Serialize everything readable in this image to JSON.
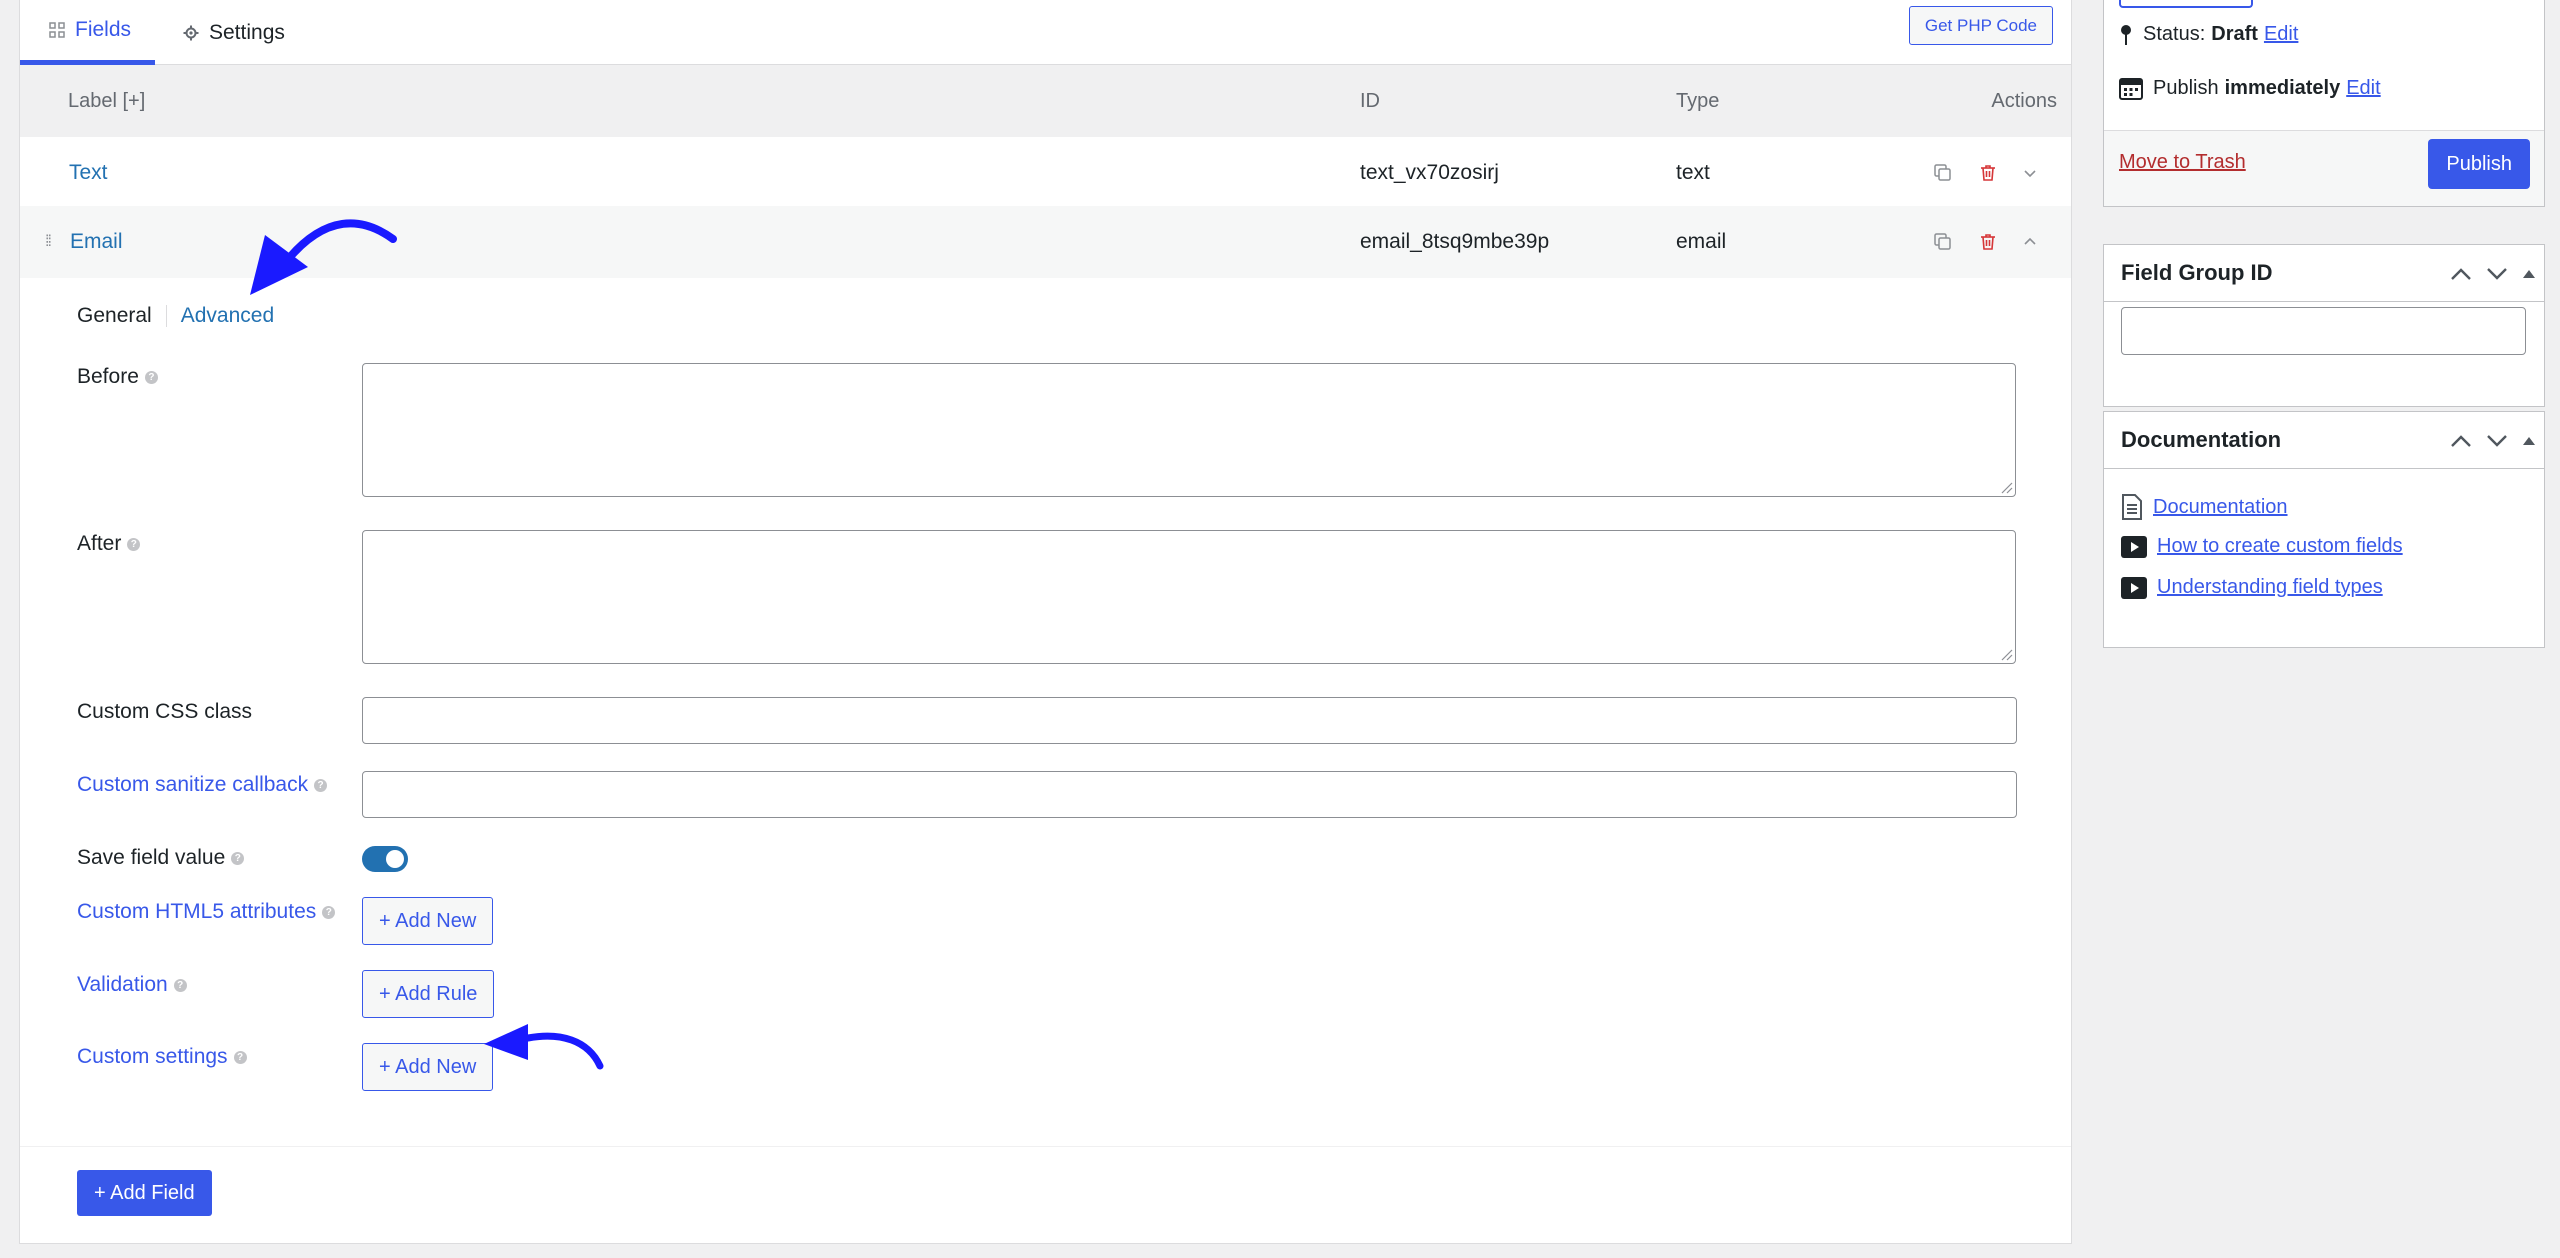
{
  "tabs": {
    "fields": "Fields",
    "settings": "Settings"
  },
  "toolbar": {
    "php_button": "Get PHP Code"
  },
  "list": {
    "headers": {
      "label": "Label [+]",
      "id": "ID",
      "type": "Type",
      "actions": "Actions"
    },
    "rows": [
      {
        "label": "Text",
        "id": "text_vx70zosirj",
        "type": "text"
      },
      {
        "label": "Email",
        "id": "email_8tsq9mbe39p",
        "type": "email"
      }
    ]
  },
  "editor": {
    "subtabs": {
      "general": "General",
      "advanced": "Advanced"
    },
    "settings": {
      "before": "Before",
      "after": "After",
      "css_class": "Custom CSS class",
      "sanitize": "Custom sanitize callback",
      "save_value": "Save field value",
      "html5_attrs": "Custom HTML5 attributes",
      "validation": "Validation",
      "custom_settings": "Custom settings"
    },
    "buttons": {
      "add_new": "+ Add New",
      "add_rule": "+ Add Rule",
      "add_field": "+ Add Field"
    },
    "save_value_enabled": true
  },
  "sidebar": {
    "publish": {
      "status_label": "Status:",
      "status_value": "Draft",
      "edit": "Edit",
      "publish_label": "Publish",
      "publish_value": "immediately",
      "trash": "Move to Trash",
      "publish_button": "Publish"
    },
    "field_group_id": {
      "title": "Field Group ID",
      "value": ""
    },
    "documentation": {
      "title": "Documentation",
      "links": [
        {
          "label": "Documentation",
          "icon": "document-icon"
        },
        {
          "label": "How to create custom fields",
          "icon": "video-icon"
        },
        {
          "label": "Understanding field types",
          "icon": "video-icon"
        }
      ]
    }
  },
  "colors": {
    "accent": "#3858e9",
    "link": "#2271b1",
    "danger": "#b32d2e",
    "arrow": "#1a1aff"
  }
}
